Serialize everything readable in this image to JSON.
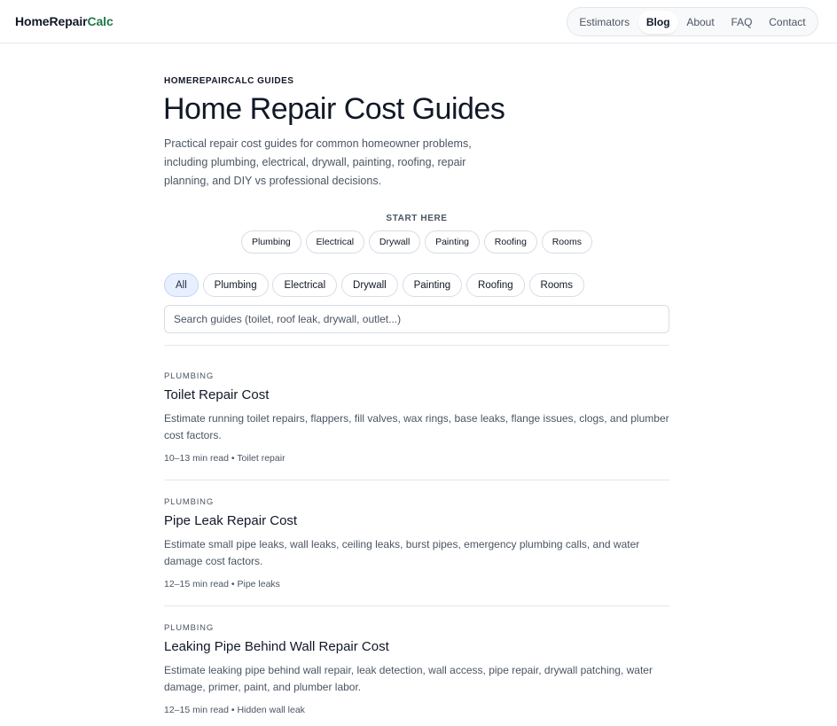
{
  "header": {
    "logo_main": "HomeRepair",
    "logo_accent": "Calc",
    "nav": [
      {
        "label": "Estimators",
        "active": false
      },
      {
        "label": "Blog",
        "active": true
      },
      {
        "label": "About",
        "active": false
      },
      {
        "label": "FAQ",
        "active": false
      },
      {
        "label": "Contact",
        "active": false
      }
    ]
  },
  "hero": {
    "eyebrow": "HOMEREPAIRCALC GUIDES",
    "title": "Home Repair Cost Guides",
    "intro": "Practical repair cost guides for common homeowner problems, including plumbing, electrical, drywall, painting, roofing, repair planning, and DIY vs professional decisions."
  },
  "start_here": {
    "label": "START HERE",
    "chips": [
      "Plumbing",
      "Electrical",
      "Drywall",
      "Painting",
      "Roofing",
      "Rooms"
    ]
  },
  "filters": {
    "chips": [
      {
        "label": "All",
        "active": true
      },
      {
        "label": "Plumbing",
        "active": false
      },
      {
        "label": "Electrical",
        "active": false
      },
      {
        "label": "Drywall",
        "active": false
      },
      {
        "label": "Painting",
        "active": false
      },
      {
        "label": "Roofing",
        "active": false
      },
      {
        "label": "Rooms",
        "active": false
      }
    ]
  },
  "search": {
    "placeholder": "Search guides (toilet, roof leak, drywall, outlet...)",
    "value": ""
  },
  "posts": [
    {
      "category": "PLUMBING",
      "title": "Toilet Repair Cost",
      "description": "Estimate running toilet repairs, flappers, fill valves, wax rings, base leaks, flange issues, clogs, and plumber cost factors.",
      "meta": "10–13 min read • Toilet repair"
    },
    {
      "category": "PLUMBING",
      "title": "Pipe Leak Repair Cost",
      "description": "Estimate small pipe leaks, wall leaks, ceiling leaks, burst pipes, emergency plumbing calls, and water damage cost factors.",
      "meta": "12–15 min read • Pipe leaks"
    },
    {
      "category": "PLUMBING",
      "title": "Leaking Pipe Behind Wall Repair Cost",
      "description": "Estimate leaking pipe behind wall repair, leak detection, wall access, pipe repair, drywall patching, water damage, primer, paint, and plumber labor.",
      "meta": "12–15 min read • Hidden wall leak"
    }
  ],
  "colors": {
    "brand_accent": "#1f7a4d",
    "active_chip_bg": "#e8effe"
  }
}
